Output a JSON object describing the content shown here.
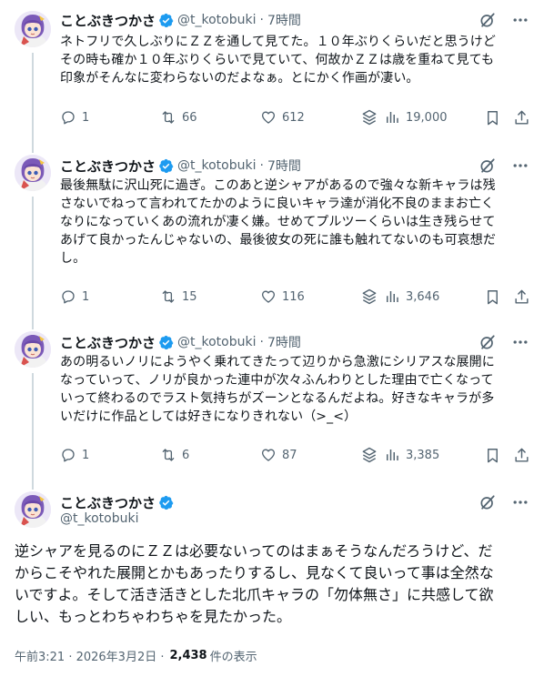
{
  "author": {
    "name": "ことぶきつかさ",
    "handle": "@t_kotobuki"
  },
  "tweets": [
    {
      "time": "7時間",
      "text": "ネトフリで久しぶりにＺＺを通して見てた。１０年ぶりくらいだと思うけど\nその時も確か１０年ぶりくらいで見ていて、何故かＺＺは歳を重ねて見ても\n印象がそんなに変わらないのだよなぁ。とにかく作画が凄い。",
      "replies": "1",
      "reposts": "66",
      "likes": "612",
      "views": "19,000"
    },
    {
      "time": "7時間",
      "text": "最後無駄に沢山死に過ぎ。このあと逆シャアがあるので強々な新キャラは残\nさないでねって言われてたかのように良いキャラ達が消化不良のままお亡く\nなりになっていくあの流れが凄く嫌。せめてプルツーくらいは生き残らせて\nあげて良かったんじゃないの、最後彼女の死に誰も触れてないのも可哀想だ\nし。",
      "replies": "1",
      "reposts": "15",
      "likes": "116",
      "views": "3,646"
    },
    {
      "time": "7時間",
      "text": "あの明るいノリにようやく乗れてきたって辺りから急激にシリアスな展開に\nなっていって、ノリが良かった連中が次々ふんわりとした理由で亡くなって\nいって終わるのでラスト気持ちがズーンとなるんだよね。好きなキャラが多\nいだけに作品としては好きになりきれない（>_<）",
      "replies": "1",
      "reposts": "6",
      "likes": "87",
      "views": "3,385"
    }
  ],
  "main_tweet": {
    "text": "逆シャアを見るのにＺＺは必要ないってのはまぁそうなんだろうけど、だ\nからこそやれた展開とかもあったりするし、見なくて良いって事は全然な\nいですよ。そして活き活きとした北爪キャラの「勿体無さ」に共感して欲\nしい、もっとわちゃわちゃを見たかった。",
    "timestamp": "午前3:21 · 2026年3月2日 · ",
    "views_count": "2,438",
    "views_label": "件の表示"
  },
  "separator": "·",
  "colors": {
    "text": "#0f1419",
    "secondary": "#536471",
    "verified": "#1d9bf0",
    "thread_line": "#cfd9de"
  },
  "icons": [
    "verified-badge-icon",
    "grok-icon",
    "more-icon",
    "reply-icon",
    "repost-icon",
    "like-icon",
    "grok-analyze-icon",
    "views-icon",
    "bookmark-icon",
    "share-icon"
  ]
}
